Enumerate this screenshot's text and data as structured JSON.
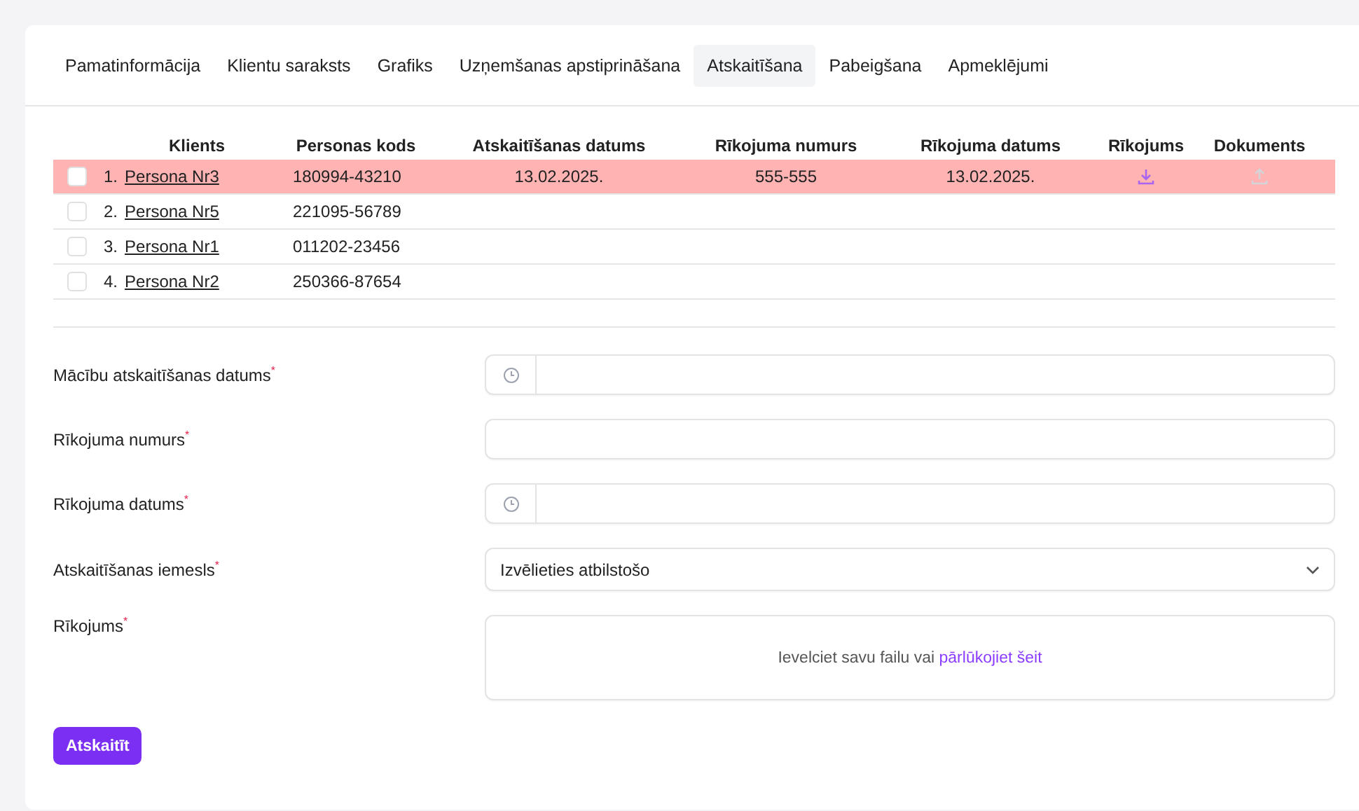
{
  "tabs": [
    {
      "label": "Pamatinformācija",
      "selected": false
    },
    {
      "label": "Klientu saraksts",
      "selected": false
    },
    {
      "label": "Grafiks",
      "selected": false
    },
    {
      "label": "Uzņemšanas apstiprināšana",
      "selected": false
    },
    {
      "label": "Atskaitīšana",
      "selected": true
    },
    {
      "label": "Pabeigšana",
      "selected": false
    },
    {
      "label": "Apmeklējumi",
      "selected": false
    }
  ],
  "table": {
    "columns": [
      "Klients",
      "Personas kods",
      "Atskaitīšanas datums",
      "Rīkojuma numurs",
      "Rīkojuma datums",
      "Rīkojums",
      "Dokuments"
    ],
    "rows": [
      {
        "selected": true,
        "checked": false,
        "number": "1.",
        "client": "Persona Nr3",
        "personal_code": "180994-43210",
        "expulsion_date": "13.02.2025.",
        "order_number": "555-555",
        "order_date": "13.02.2025.",
        "has_order": true,
        "has_document": false
      },
      {
        "selected": false,
        "checked": false,
        "number": "2.",
        "client": "Persona Nr5",
        "personal_code": "221095-56789"
      },
      {
        "selected": false,
        "checked": false,
        "number": "3.",
        "client": "Persona Nr1",
        "personal_code": "011202-23456"
      },
      {
        "selected": false,
        "checked": false,
        "number": "4.",
        "client": "Persona Nr2",
        "personal_code": "250366-87654"
      }
    ]
  },
  "form": {
    "fields": [
      {
        "kind": "date",
        "label": "Mācību atskaitīšanas datums$^{*}$"
      },
      {
        "kind": "text",
        "label": "Rīkojuma numurs$^{*}$"
      },
      {
        "kind": "date",
        "label": "Rīkojuma datums$^{*}$"
      },
      {
        "kind": "select",
        "label": "Atskaitīšanas iemesls$^{*}$",
        "value": "Izvēlieties atbilstošo"
      },
      {
        "kind": "upload",
        "label": "Rīkojums$^{*}$",
        "text": "Ievelciet savu failu vai ",
        "link": "pārlūkojiet šeit"
      }
    ],
    "submit": "Atskaitīt"
  }
}
